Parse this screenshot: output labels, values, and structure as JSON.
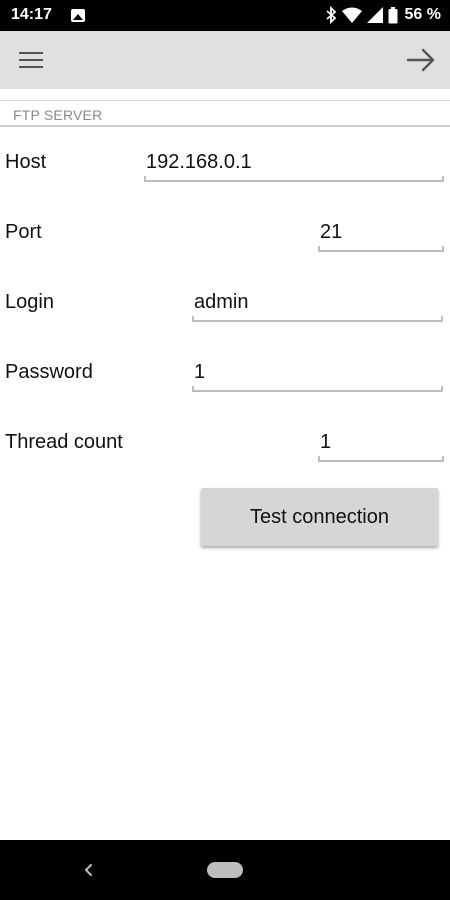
{
  "status_bar": {
    "time": "14:17",
    "battery_percent": "56 %",
    "icons": [
      "image-icon",
      "bluetooth-icon",
      "wifi-icon",
      "signal-icon",
      "battery-icon"
    ]
  },
  "toolbar": {
    "left_icon": "menu-icon",
    "right_icon": "arrow-forward-icon"
  },
  "section": {
    "title": "FTP SERVER"
  },
  "form": {
    "host": {
      "label": "Host",
      "value": "192.168.0.1"
    },
    "port": {
      "label": "Port",
      "value": "21"
    },
    "login": {
      "label": "Login",
      "value": "admin"
    },
    "password": {
      "label": "Password",
      "value": "1"
    },
    "thread_count": {
      "label": "Thread count",
      "value": "1"
    }
  },
  "actions": {
    "test_connection_label": "Test connection"
  },
  "nav_bar": {
    "icons": [
      "back-icon",
      "home-pill-icon"
    ]
  },
  "colors": {
    "toolbar_bg": "#e0e0e0",
    "button_bg": "#d6d6d6",
    "underline": "#bdbdbd",
    "section_title": "#8a8a8a"
  }
}
